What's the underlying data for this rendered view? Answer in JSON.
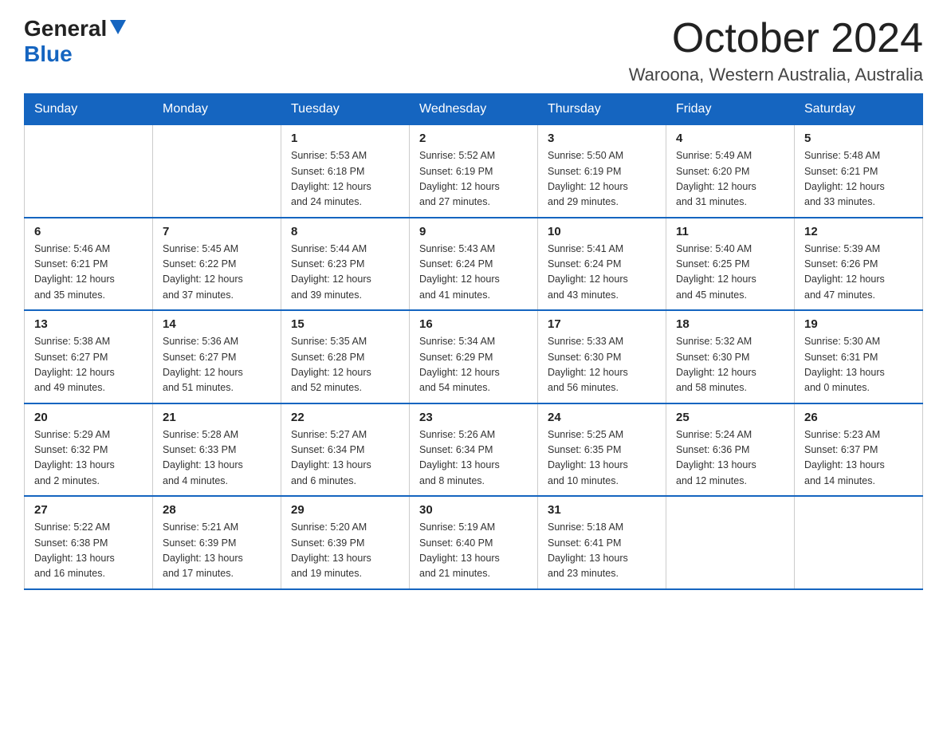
{
  "logo": {
    "general": "General",
    "blue": "Blue",
    "triangle_color": "#1565c0"
  },
  "title": {
    "month": "October 2024",
    "location": "Waroona, Western Australia, Australia"
  },
  "weekdays": [
    "Sunday",
    "Monday",
    "Tuesday",
    "Wednesday",
    "Thursday",
    "Friday",
    "Saturday"
  ],
  "weeks": [
    [
      {
        "day": "",
        "info": ""
      },
      {
        "day": "",
        "info": ""
      },
      {
        "day": "1",
        "info": "Sunrise: 5:53 AM\nSunset: 6:18 PM\nDaylight: 12 hours\nand 24 minutes."
      },
      {
        "day": "2",
        "info": "Sunrise: 5:52 AM\nSunset: 6:19 PM\nDaylight: 12 hours\nand 27 minutes."
      },
      {
        "day": "3",
        "info": "Sunrise: 5:50 AM\nSunset: 6:19 PM\nDaylight: 12 hours\nand 29 minutes."
      },
      {
        "day": "4",
        "info": "Sunrise: 5:49 AM\nSunset: 6:20 PM\nDaylight: 12 hours\nand 31 minutes."
      },
      {
        "day": "5",
        "info": "Sunrise: 5:48 AM\nSunset: 6:21 PM\nDaylight: 12 hours\nand 33 minutes."
      }
    ],
    [
      {
        "day": "6",
        "info": "Sunrise: 5:46 AM\nSunset: 6:21 PM\nDaylight: 12 hours\nand 35 minutes."
      },
      {
        "day": "7",
        "info": "Sunrise: 5:45 AM\nSunset: 6:22 PM\nDaylight: 12 hours\nand 37 minutes."
      },
      {
        "day": "8",
        "info": "Sunrise: 5:44 AM\nSunset: 6:23 PM\nDaylight: 12 hours\nand 39 minutes."
      },
      {
        "day": "9",
        "info": "Sunrise: 5:43 AM\nSunset: 6:24 PM\nDaylight: 12 hours\nand 41 minutes."
      },
      {
        "day": "10",
        "info": "Sunrise: 5:41 AM\nSunset: 6:24 PM\nDaylight: 12 hours\nand 43 minutes."
      },
      {
        "day": "11",
        "info": "Sunrise: 5:40 AM\nSunset: 6:25 PM\nDaylight: 12 hours\nand 45 minutes."
      },
      {
        "day": "12",
        "info": "Sunrise: 5:39 AM\nSunset: 6:26 PM\nDaylight: 12 hours\nand 47 minutes."
      }
    ],
    [
      {
        "day": "13",
        "info": "Sunrise: 5:38 AM\nSunset: 6:27 PM\nDaylight: 12 hours\nand 49 minutes."
      },
      {
        "day": "14",
        "info": "Sunrise: 5:36 AM\nSunset: 6:27 PM\nDaylight: 12 hours\nand 51 minutes."
      },
      {
        "day": "15",
        "info": "Sunrise: 5:35 AM\nSunset: 6:28 PM\nDaylight: 12 hours\nand 52 minutes."
      },
      {
        "day": "16",
        "info": "Sunrise: 5:34 AM\nSunset: 6:29 PM\nDaylight: 12 hours\nand 54 minutes."
      },
      {
        "day": "17",
        "info": "Sunrise: 5:33 AM\nSunset: 6:30 PM\nDaylight: 12 hours\nand 56 minutes."
      },
      {
        "day": "18",
        "info": "Sunrise: 5:32 AM\nSunset: 6:30 PM\nDaylight: 12 hours\nand 58 minutes."
      },
      {
        "day": "19",
        "info": "Sunrise: 5:30 AM\nSunset: 6:31 PM\nDaylight: 13 hours\nand 0 minutes."
      }
    ],
    [
      {
        "day": "20",
        "info": "Sunrise: 5:29 AM\nSunset: 6:32 PM\nDaylight: 13 hours\nand 2 minutes."
      },
      {
        "day": "21",
        "info": "Sunrise: 5:28 AM\nSunset: 6:33 PM\nDaylight: 13 hours\nand 4 minutes."
      },
      {
        "day": "22",
        "info": "Sunrise: 5:27 AM\nSunset: 6:34 PM\nDaylight: 13 hours\nand 6 minutes."
      },
      {
        "day": "23",
        "info": "Sunrise: 5:26 AM\nSunset: 6:34 PM\nDaylight: 13 hours\nand 8 minutes."
      },
      {
        "day": "24",
        "info": "Sunrise: 5:25 AM\nSunset: 6:35 PM\nDaylight: 13 hours\nand 10 minutes."
      },
      {
        "day": "25",
        "info": "Sunrise: 5:24 AM\nSunset: 6:36 PM\nDaylight: 13 hours\nand 12 minutes."
      },
      {
        "day": "26",
        "info": "Sunrise: 5:23 AM\nSunset: 6:37 PM\nDaylight: 13 hours\nand 14 minutes."
      }
    ],
    [
      {
        "day": "27",
        "info": "Sunrise: 5:22 AM\nSunset: 6:38 PM\nDaylight: 13 hours\nand 16 minutes."
      },
      {
        "day": "28",
        "info": "Sunrise: 5:21 AM\nSunset: 6:39 PM\nDaylight: 13 hours\nand 17 minutes."
      },
      {
        "day": "29",
        "info": "Sunrise: 5:20 AM\nSunset: 6:39 PM\nDaylight: 13 hours\nand 19 minutes."
      },
      {
        "day": "30",
        "info": "Sunrise: 5:19 AM\nSunset: 6:40 PM\nDaylight: 13 hours\nand 21 minutes."
      },
      {
        "day": "31",
        "info": "Sunrise: 5:18 AM\nSunset: 6:41 PM\nDaylight: 13 hours\nand 23 minutes."
      },
      {
        "day": "",
        "info": ""
      },
      {
        "day": "",
        "info": ""
      }
    ]
  ]
}
